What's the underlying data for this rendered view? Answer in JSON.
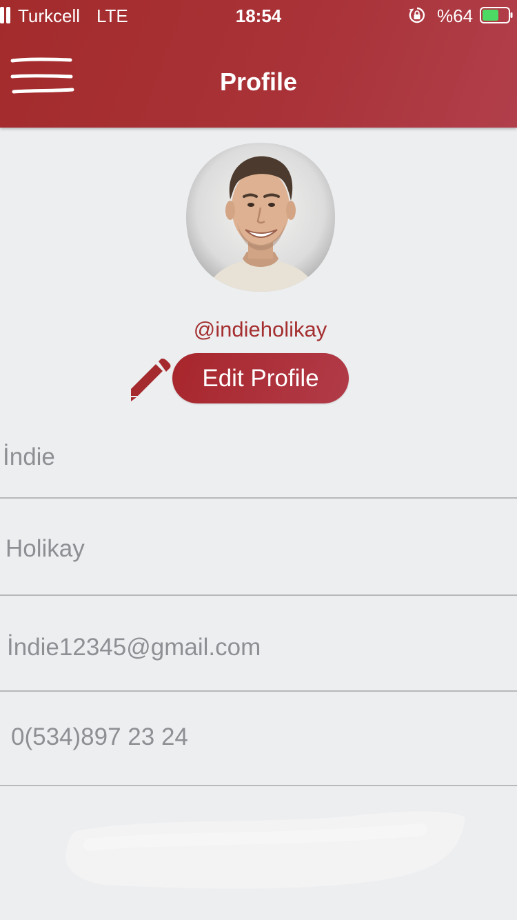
{
  "status_bar": {
    "carrier": "Turkcell",
    "network": "LTE",
    "time": "18:54",
    "battery_percent": "%64",
    "battery_level": 0.64,
    "icons": [
      "signal-icon",
      "rotation-lock-icon",
      "battery-icon"
    ]
  },
  "header": {
    "title": "Profile",
    "menu_icon": "hamburger-menu-icon",
    "background_color": "#a9323a"
  },
  "profile": {
    "username": "@indieholikay",
    "edit_button_label": "Edit Profile",
    "edit_icon": "pencil-icon",
    "accent_color": "#a52f30"
  },
  "fields": {
    "first_name": "İndie",
    "last_name": "Holikay",
    "email": "İndie12345@gmail.com",
    "phone": "0(534)897 23 24"
  }
}
